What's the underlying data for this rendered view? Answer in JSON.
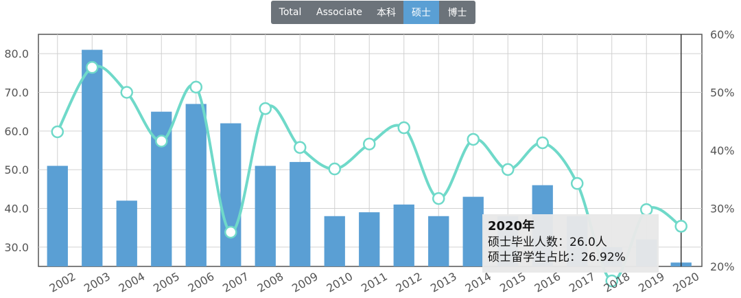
{
  "tabs": [
    {
      "label": "Total",
      "active": false
    },
    {
      "label": "Associate",
      "active": false
    },
    {
      "label": "本科",
      "active": false
    },
    {
      "label": "硕士",
      "active": true
    },
    {
      "label": "博士",
      "active": false
    }
  ],
  "colors": {
    "bar": "#5a9fd4",
    "line": "#6fd9c9",
    "accent": "#5a9fd4"
  },
  "chart_data": {
    "type": "bar",
    "categories": [
      "2002",
      "2003",
      "2004",
      "2005",
      "2006",
      "2007",
      "2008",
      "2009",
      "2010",
      "2011",
      "2012",
      "2013",
      "2014",
      "2015",
      "2016",
      "2017",
      "2018",
      "2019",
      "2020"
    ],
    "series": [
      {
        "values": [
          51,
          81,
          42,
          65,
          67,
          62,
          51,
          52,
          38,
          39,
          41,
          38,
          43,
          38,
          46,
          38,
          30,
          32,
          26
        ]
      },
      {
        "values": [
          43.2,
          54.3,
          50.0,
          41.6,
          50.9,
          25.9,
          47.2,
          40.5,
          36.8,
          41.1,
          43.9,
          31.7,
          41.9,
          36.7,
          41.3,
          34.3,
          17.5,
          29.8,
          26.92
        ]
      }
    ],
    "yTicksLeft": [
      "30.0",
      "40.0",
      "50.0",
      "60.0",
      "70.0",
      "80.0"
    ],
    "yTicksRight": [
      "20%",
      "30%",
      "40%",
      "50%",
      "60%"
    ],
    "ylim_left": [
      25,
      85
    ],
    "ylim_right": [
      20,
      60
    ],
    "grid": true
  },
  "tooltip": {
    "title": "2020年",
    "line1": "硕士毕业人数：26.0人",
    "line2": "硕士留学生占比：26.92%"
  }
}
